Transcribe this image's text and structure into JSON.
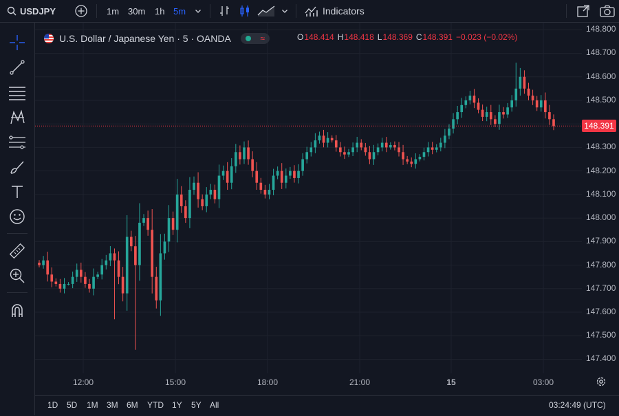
{
  "toolbar": {
    "symbol": "USDJPY",
    "intervals": [
      "1m",
      "30m",
      "1h",
      "5m"
    ],
    "active_interval": "5m",
    "indicators_label": "Indicators"
  },
  "legend": {
    "title": "U.S. Dollar / Japanese Yen · 5 · OANDA",
    "open_k": "O",
    "open": "148.414",
    "high_k": "H",
    "high": "148.418",
    "low_k": "L",
    "low": "148.369",
    "close_k": "C",
    "close": "148.391",
    "change": "−0.023 (−0.02%)"
  },
  "colors": {
    "up": "#26a69a",
    "down": "#ef5350",
    "bg": "#131722",
    "accent": "#2962ff",
    "last_price": "#f23645"
  },
  "last_price_label": "148.391",
  "chart_data": {
    "type": "candlestick",
    "y_ticks": [
      "148.800",
      "148.700",
      "148.600",
      "148.500",
      "148.400",
      "148.300",
      "148.200",
      "148.100",
      "148.000",
      "147.900",
      "147.800",
      "147.700",
      "147.600",
      "147.500",
      "147.400"
    ],
    "y_tick_values": [
      148.8,
      148.7,
      148.6,
      148.5,
      148.4,
      148.3,
      148.2,
      148.1,
      148.0,
      147.9,
      147.8,
      147.7,
      147.6,
      147.5,
      147.4
    ],
    "ylim": [
      147.34,
      148.83
    ],
    "x_ticks": [
      "12:00",
      "15:00",
      "18:00",
      "21:00",
      "15",
      "03:00"
    ],
    "last_price": 148.391,
    "closes": [
      147.8,
      147.82,
      147.76,
      147.73,
      147.72,
      147.7,
      147.72,
      147.72,
      147.75,
      147.78,
      147.75,
      147.72,
      147.7,
      147.75,
      147.76,
      147.8,
      147.82,
      147.85,
      147.82,
      147.75,
      147.68,
      147.92,
      147.88,
      147.8,
      147.98,
      148.0,
      147.95,
      147.75,
      147.65,
      147.85,
      147.9,
      148.0,
      147.95,
      148.1,
      148.05,
      148.0,
      148.12,
      148.15,
      148.08,
      148.05,
      148.1,
      148.12,
      148.08,
      148.18,
      148.2,
      148.15,
      148.22,
      148.28,
      148.25,
      148.3,
      148.25,
      148.2,
      148.15,
      148.12,
      148.1,
      148.12,
      148.18,
      148.2,
      148.15,
      148.18,
      148.2,
      148.17,
      148.2,
      148.25,
      148.28,
      148.3,
      148.33,
      148.35,
      148.32,
      148.34,
      148.33,
      148.3,
      148.28,
      148.27,
      148.28,
      148.3,
      148.32,
      148.3,
      148.28,
      148.25,
      148.28,
      148.3,
      148.32,
      148.3,
      148.31,
      148.3,
      148.28,
      148.25,
      148.24,
      148.23,
      148.25,
      148.26,
      148.28,
      148.3,
      148.29,
      148.3,
      148.32,
      148.35,
      148.38,
      148.42,
      148.45,
      148.48,
      148.5,
      148.52,
      148.49,
      148.46,
      148.43,
      148.45,
      148.42,
      148.4,
      148.45,
      148.44,
      148.47,
      148.5,
      148.55,
      148.6,
      148.55,
      148.52,
      148.5,
      148.47,
      148.5,
      148.45,
      148.42,
      148.39
    ]
  },
  "range_buttons": [
    "1D",
    "5D",
    "1M",
    "3M",
    "6M",
    "YTD",
    "1Y",
    "5Y",
    "All"
  ],
  "clock": "03:24:49 (UTC)"
}
